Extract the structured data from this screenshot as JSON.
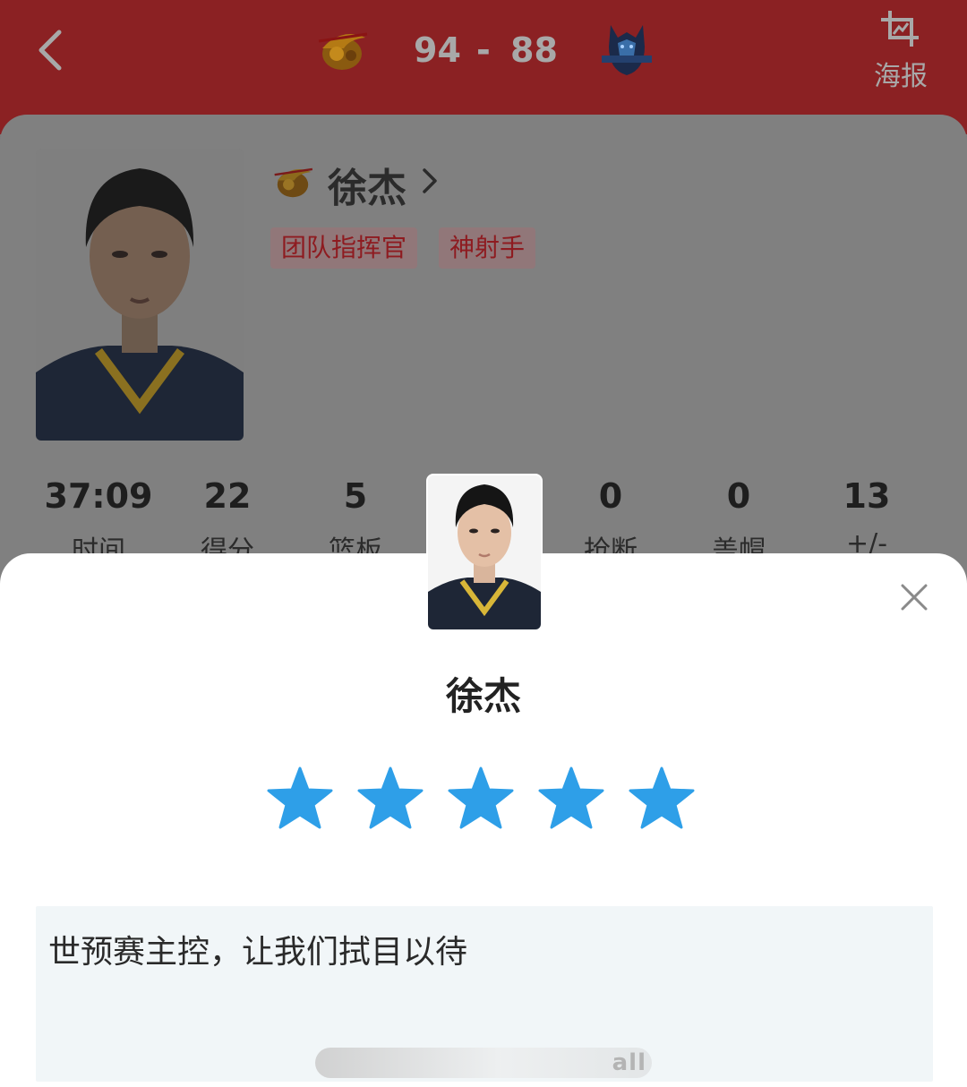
{
  "header": {
    "score_home": "94",
    "score_separator": "-",
    "score_away": "88",
    "poster_label": "海报",
    "home_logo_text": "Guangdong",
    "away_logo_text": "SHANDONG",
    "colors": {
      "background": "#8b2123",
      "text": "#a8a8a8"
    }
  },
  "player": {
    "name": "徐杰",
    "tags": [
      "团队指挥官",
      "神射手"
    ]
  },
  "stats": [
    {
      "value": "37:09",
      "label": "时间"
    },
    {
      "value": "22",
      "label": "得分"
    },
    {
      "value": "5",
      "label": "篮板"
    },
    {
      "value": "0",
      "label": "抢断"
    },
    {
      "value": "0",
      "label": "盖帽"
    },
    {
      "value": "13",
      "label": "+/-"
    }
  ],
  "rating_sheet": {
    "name": "徐杰",
    "rating": 5,
    "rating_max": 5,
    "star_color": "#2e9fe8",
    "comment": "世预赛主控，让我们拭目以待",
    "watermark_text": "all"
  },
  "icons": [
    "chevron-left-icon",
    "poster-icon",
    "chevron-right-icon",
    "close-icon",
    "star-icon"
  ]
}
